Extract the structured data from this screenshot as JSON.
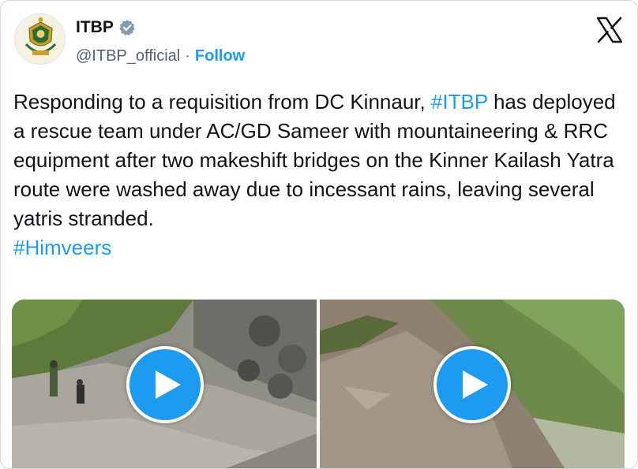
{
  "author": {
    "name": "ITBP",
    "handle": "@ITBP_official",
    "separator": "·",
    "follow_label": "Follow",
    "verified_icon": "verified-badge-icon"
  },
  "platform_logo": "x-logo-icon",
  "tweet": {
    "text_main": "Responding to a requisition from DC Kinnaur, ",
    "hashtag_1": "#ITBP",
    "text_rest": " has deployed a rescue team under AC/GD Sameer with mountaineering & RRC equipment after two makeshift bridges on the Kinner Kailash Yatra route were washed away due to incessant rains, leaving several yatris stranded.",
    "hashtag_2": "#Himveers"
  },
  "media": [
    {
      "type": "video",
      "icon": "play-icon"
    },
    {
      "type": "video",
      "icon": "play-icon"
    }
  ],
  "colors": {
    "accent": "#1d9bf0",
    "text": "#0f1419",
    "secondary": "#536471",
    "border": "#cfd9de"
  }
}
